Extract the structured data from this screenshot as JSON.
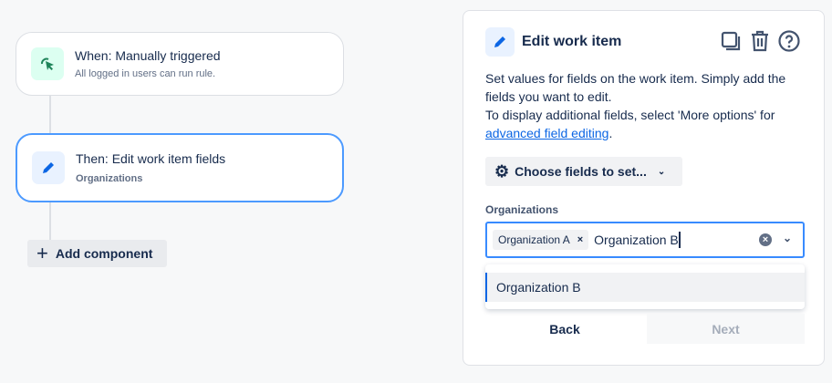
{
  "flow": {
    "trigger": {
      "title": "When: Manually triggered",
      "subtitle": "All logged in users can run rule."
    },
    "action": {
      "title": "Then: Edit work item fields",
      "subtitle": "Organizations"
    },
    "add_component": "Add component"
  },
  "panel": {
    "title": "Edit work item",
    "desc_line1": "Set values for fields on the work item. Simply add the fields you want to edit.",
    "desc_line2": "To display additional fields, select 'More options' for ",
    "desc_link": "advanced field editing",
    "desc_end": ".",
    "choose_fields": "Choose fields to set...",
    "field_label": "Organizations",
    "selected_tag": "Organization A",
    "input_value": "Organization B",
    "options": [
      "Organization B"
    ],
    "back": "Back",
    "next": "Next"
  },
  "colors": {
    "accent": "#388bff",
    "trigger_icon": "#1f845a",
    "edit_icon": "#0c66e4"
  }
}
